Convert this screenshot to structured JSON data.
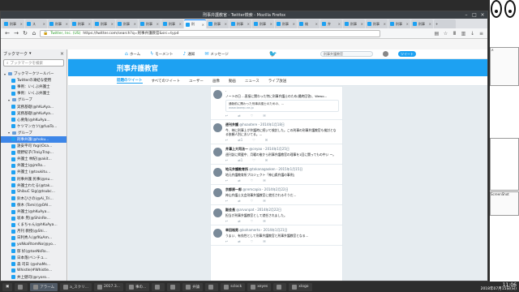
{
  "window": {
    "title": "刑事弁護教官 - Twitter検索 - Mozilla Firefox"
  },
  "tabs": [
    {
      "label": "刑事",
      "active": false
    },
    {
      "label": "ス",
      "active": false
    },
    {
      "label": "刑事",
      "active": false
    },
    {
      "label": "刑事",
      "active": false
    },
    {
      "label": "刑事",
      "active": false
    },
    {
      "label": "刑事",
      "active": false
    },
    {
      "label": "刑事",
      "active": false
    },
    {
      "label": "刑事",
      "active": false
    },
    {
      "label": "刑",
      "active": true
    },
    {
      "label": "刑事",
      "active": false
    },
    {
      "label": "刑事",
      "active": false
    },
    {
      "label": "刑事",
      "active": false
    },
    {
      "label": "刑事",
      "active": false
    },
    {
      "label": "検",
      "active": false
    },
    {
      "label": "弁",
      "active": false
    },
    {
      "label": "刑事",
      "active": false
    },
    {
      "label": "刑事",
      "active": false
    },
    {
      "label": "刑事",
      "active": false
    },
    {
      "label": "刑事",
      "active": false
    }
  ],
  "navbar": {
    "org": "Twitter, Inc. (US)",
    "url": "https://twitter.com/search?q=刑事弁護教官&src=typd"
  },
  "sidebar": {
    "title": "ブックマーク",
    "search_placeholder": "ブックマークを検索",
    "items": [
      {
        "label": "ブックマークツールバー",
        "kind": "folder",
        "depth": 0,
        "selected": false
      },
      {
        "label": "Twitterの凍結な使用",
        "kind": "page",
        "depth": 2,
        "selected": false
      },
      {
        "label": "事例：いくぶ弁護士",
        "kind": "page",
        "depth": 2,
        "selected": false
      },
      {
        "label": "事例：いくぶ弁護士",
        "kind": "page",
        "depth": 2,
        "selected": false
      },
      {
        "label": "グループ",
        "kind": "folder",
        "depth": 1,
        "selected": false
      },
      {
        "label": "実務基礎(@hKuAya...",
        "kind": "page",
        "depth": 2,
        "selected": false
      },
      {
        "label": "実務基礎(@hKuAya...",
        "kind": "page",
        "depth": 2,
        "selected": false
      },
      {
        "label": "心要角(@hKuAya...",
        "kind": "page",
        "depth": 2,
        "selected": false
      },
      {
        "label": "ケツマンカツ(@fuaTo...",
        "kind": "page",
        "depth": 2,
        "selected": false
      },
      {
        "label": "グループ",
        "kind": "folder",
        "depth": 1,
        "selected": false
      },
      {
        "label": "刑事弁護(@hoku...",
        "kind": "page",
        "depth": 2,
        "selected": true
      },
      {
        "label": "遠安平司 Yogi(Oca...",
        "kind": "page",
        "depth": 2,
        "selected": false
      },
      {
        "label": "徳野紀子(TroLyTrap...",
        "kind": "page",
        "depth": 2,
        "selected": false
      },
      {
        "label": "弁護士 林紀(@akit...",
        "kind": "page",
        "depth": 2,
        "selected": false
      },
      {
        "label": "弁護士(@jmRo...",
        "kind": "page",
        "depth": 2,
        "selected": false
      },
      {
        "label": "弁護士 (@toukitu...",
        "kind": "page",
        "depth": 2,
        "selected": false
      },
      {
        "label": "刑事弁護 民事(@nu...",
        "kind": "page",
        "depth": 2,
        "selected": false
      },
      {
        "label": "弁護士わたる(@tak...",
        "kind": "page",
        "depth": 2,
        "selected": false
      },
      {
        "label": "ShibuC Sig(@tsubc...",
        "kind": "page",
        "depth": 2,
        "selected": false
      },
      {
        "label": "鈴木ひさの(@Ai_Tri...",
        "kind": "page",
        "depth": 2,
        "selected": false
      },
      {
        "label": "保木 (Tomi)(@OAI...",
        "kind": "page",
        "depth": 2,
        "selected": false
      },
      {
        "label": "弁護士(@hKuAya...",
        "kind": "page",
        "depth": 2,
        "selected": false
      },
      {
        "label": "坂本 晃(@ShinRe...",
        "kind": "page",
        "depth": 2,
        "selected": false
      },
      {
        "label": "くまちゃん(@hKuAya...",
        "kind": "page",
        "depth": 2,
        "selected": false
      },
      {
        "label": "月刊 教授(@Shi...",
        "kind": "page",
        "depth": 2,
        "selected": false
      },
      {
        "label": "日利秀人(@fKuAm...",
        "kind": "page",
        "depth": 2,
        "selected": false
      },
      {
        "label": "yoNkaRtomNo(@yo...",
        "kind": "page",
        "depth": 2,
        "selected": false
      },
      {
        "label": "郁 好(@toeNkRo...",
        "kind": "page",
        "depth": 2,
        "selected": false
      },
      {
        "label": "日本落(ベンチュ...",
        "kind": "page",
        "depth": 2,
        "selected": false
      },
      {
        "label": "森 司日 (@shaMs...",
        "kind": "page",
        "depth": 2,
        "selected": false
      },
      {
        "label": "Whistle(#Whistle...",
        "kind": "page",
        "depth": 2,
        "selected": false
      },
      {
        "label": "井上健司(@ryoro...",
        "kind": "page",
        "depth": 2,
        "selected": false
      },
      {
        "label": "松林泰泰(@enuab...",
        "kind": "page",
        "depth": 2,
        "selected": false
      },
      {
        "label": "Kouki.Ezza(Kno...",
        "kind": "page",
        "depth": 2,
        "selected": false
      },
      {
        "label": "Yoshiki Tanaka(...",
        "kind": "page",
        "depth": 2,
        "selected": false
      },
      {
        "label": "弁護士(@GryuSub...",
        "kind": "page",
        "depth": 2,
        "selected": false
      }
    ]
  },
  "twitter": {
    "nav": [
      {
        "label": "ホーム",
        "icon": "home-icon"
      },
      {
        "label": "モーメント",
        "icon": "bolt-icon"
      },
      {
        "label": "通知",
        "icon": "bell-icon"
      },
      {
        "label": "メッセージ",
        "icon": "mail-icon"
      }
    ],
    "search_value": "刑事弁護教官",
    "tweet_button": "ツイート",
    "search_title": "刑事弁護教官",
    "search_tabs": [
      "話題のツイート",
      "すべてのツイート",
      "ユーザー",
      "画像",
      "動画",
      "ニュース",
      "ライブ放送"
    ],
    "tweets": [
      {
        "name": "",
        "handle": "",
        "date": "",
        "text": "ノートの日 ...直接に関わった特に刑事弁護士のため(最終回答)、Wewo...",
        "card": "通勤前に関わった刑事弁護士のための、...",
        "card_url": "www.tweep.ne.jp",
        "counts": [
          "",
          "",
          "",
          ""
        ]
      },
      {
        "name": "週刊弁護",
        "handle": "@hoaotere",
        "date": "2014年1月18日",
        "text": "今、神に刑事上が弁護時に続いて検討した。この刑事の刑事弁護教官も検討となる依頼人別においてる。...",
        "card": "",
        "card_url": "",
        "counts": [
          "",
          "1",
          "",
          ""
        ]
      },
      {
        "name": "井澤上大司法ー",
        "handle": "@ceyao",
        "date": "2014年1月25日",
        "text": "週刊誌に掲載中、月曜の後から刑事弁護教官の理事を1回に関ってもの中い ー。",
        "card": "",
        "card_url": "",
        "counts": [
          "",
          "1",
          "",
          ""
        ]
      },
      {
        "name": "地元弁護教育所",
        "handle": "@tokanagaoken",
        "date": "2015年1月15日",
        "text": "地元弁護教育所プロジェクト「神山県弁護の事例」",
        "card": "",
        "card_url": "",
        "counts": [
          "",
          "",
          "",
          ""
        ]
      },
      {
        "name": "京都原一郎",
        "handle": "@remcapia",
        "date": "2014年2月22日",
        "text": "神山弁護士太会刑事弁護教官に就任されるそうだ...",
        "card": "",
        "card_url": "",
        "counts": [
          "",
          "",
          "",
          ""
        ]
      },
      {
        "name": "副会長",
        "handle": "@arvunpat",
        "date": "2014年2月22日",
        "text": "担当が刑事弁護教官として就任されました。",
        "card": "",
        "card_url": "",
        "counts": [
          "",
          "",
          "",
          ""
        ]
      },
      {
        "name": "幸田裕男",
        "handle": "@kohamerto",
        "date": "2014年1月21日",
        "text": "うまい、有効性として刑事弁護教官と刑事弁護教官となる...",
        "card": "",
        "card_url": "",
        "counts": [
          "",
          "",
          "",
          ""
        ]
      }
    ]
  },
  "right_windows": [
    {
      "label": "メ"
    },
    {
      "label": ""
    },
    {
      "label": "ScreenShot"
    }
  ],
  "taskbar": {
    "apps": [
      "",
      "アラーム",
      "a_スクリ...",
      "2017.3...",
      "事の...",
      "",
      "",
      "弁論",
      "",
      "sclock",
      "xeyes",
      "",
      "xlogo"
    ],
    "time": "11:06",
    "date": "2018年07月15日(日)"
  }
}
